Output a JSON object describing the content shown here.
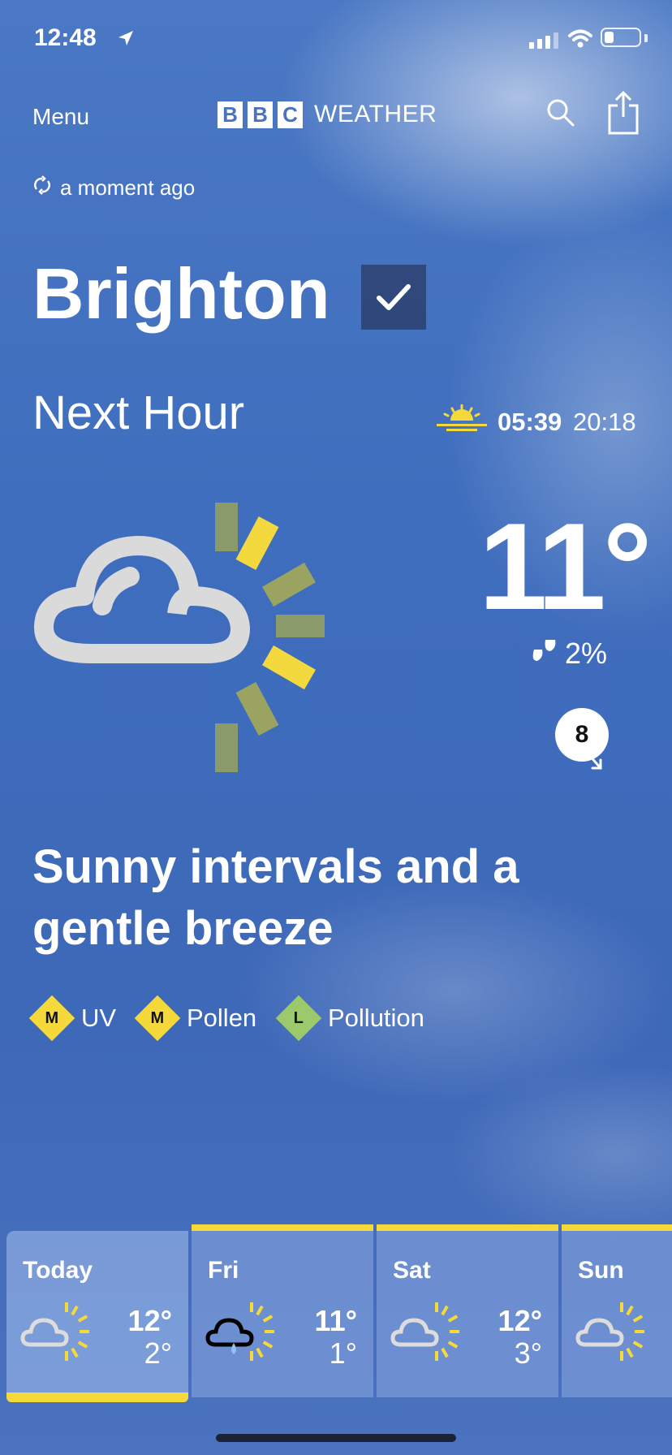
{
  "status_bar": {
    "time": "12:48"
  },
  "nav": {
    "menu_label": "Menu",
    "logo_letters": [
      "B",
      "B",
      "C"
    ],
    "logo_word": "WEATHER",
    "search_icon": "search-icon",
    "share_icon": "share-icon"
  },
  "updated": "a moment ago",
  "location": {
    "name": "Brighton",
    "favourite": true
  },
  "period_title": "Next Hour",
  "sun": {
    "sunrise": "05:39",
    "sunset": "20:18"
  },
  "current": {
    "icon": "sunny-intervals-icon",
    "temperature": "11°",
    "rain_chance": "2%",
    "wind_speed": "8",
    "description": "Sunny intervals and a gentle breeze"
  },
  "indices": [
    {
      "level": "M",
      "label": "UV",
      "color": "#f5d93b"
    },
    {
      "level": "M",
      "label": "Pollen",
      "color": "#f5d93b"
    },
    {
      "level": "L",
      "label": "Pollution",
      "color": "#9bc96b"
    }
  ],
  "forecast": [
    {
      "day": "Today",
      "high": "12°",
      "low": "2°",
      "icon": "sunny-intervals-icon"
    },
    {
      "day": "Fri",
      "high": "11°",
      "low": "1°",
      "icon": "light-rain-icon"
    },
    {
      "day": "Sat",
      "high": "12°",
      "low": "3°",
      "icon": "sunny-intervals-icon"
    },
    {
      "day": "Sun",
      "high": "",
      "low": "",
      "icon": "sunny-intervals-icon"
    }
  ],
  "colors": {
    "accent": "#f5d93b",
    "background": "#4a72bf"
  }
}
